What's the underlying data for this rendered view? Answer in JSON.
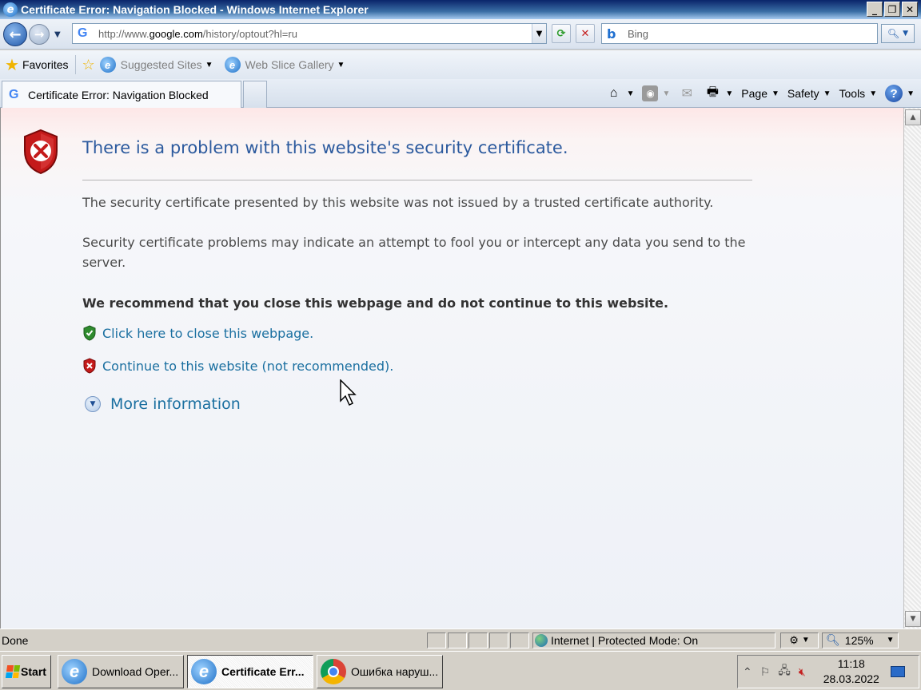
{
  "window": {
    "title": "Certificate Error: Navigation Blocked - Windows Internet Explorer",
    "minimize": "_",
    "restore": "❐",
    "close": "✕"
  },
  "address": {
    "url_prefix": "http://www.",
    "url_domain": "google.com",
    "url_rest": "/history/optout?hl=ru",
    "search_placeholder": "Bing"
  },
  "favorites": {
    "label": "Favorites",
    "links": [
      "Suggested Sites",
      "Web Slice Gallery"
    ]
  },
  "tabs": {
    "active_title": "Certificate Error: Navigation Blocked"
  },
  "commands": {
    "page": "Page",
    "safety": "Safety",
    "tools": "Tools",
    "help": "?"
  },
  "content": {
    "title": "There is a problem with this website's security certificate.",
    "para1": "The security certificate presented by this website was not issued by a trusted certificate authority.",
    "para2": "Security certificate problems may indicate an attempt to fool you or intercept any data you send to the server.",
    "recommend": "We recommend that you close this webpage and do not continue to this website.",
    "close_link": "Click here to close this webpage.",
    "continue_link": "Continue to this website (not recommended).",
    "more_info": "More information"
  },
  "status": {
    "text": "Done",
    "zone": "Internet | Protected Mode: On",
    "zoom": "125%"
  },
  "taskbar": {
    "start": "Start",
    "tasks": [
      "Download Oper...",
      "Certificate Err...",
      "Ошибка наруш..."
    ],
    "time": "11:18",
    "date": "28.03.2022"
  },
  "colors": {
    "title_blue": "#2c5a9e",
    "link_blue": "#1a6fa0",
    "shield_red": "#c41a1a",
    "shield_green": "#2e8b2e"
  }
}
